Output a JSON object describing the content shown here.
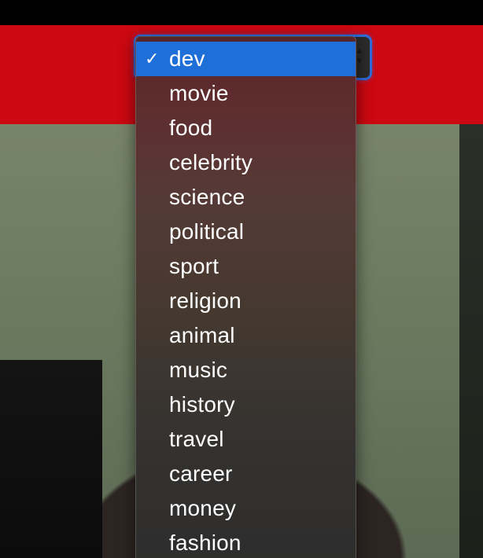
{
  "colors": {
    "header_red": "#cc0812",
    "selection_blue": "#1f6fd9",
    "focus_ring": "#2f6bd9"
  },
  "select": {
    "selected_value": "dev",
    "stepper_icon": "chevron-up-down-icon"
  },
  "dropdown": {
    "checkmark_glyph": "✓",
    "options": [
      {
        "label": "dev",
        "selected": true
      },
      {
        "label": "movie"
      },
      {
        "label": "food"
      },
      {
        "label": "celebrity"
      },
      {
        "label": "science"
      },
      {
        "label": "political"
      },
      {
        "label": "sport"
      },
      {
        "label": "religion"
      },
      {
        "label": "animal"
      },
      {
        "label": "music"
      },
      {
        "label": "history"
      },
      {
        "label": "travel"
      },
      {
        "label": "career"
      },
      {
        "label": "money"
      },
      {
        "label": "fashion"
      }
    ]
  }
}
